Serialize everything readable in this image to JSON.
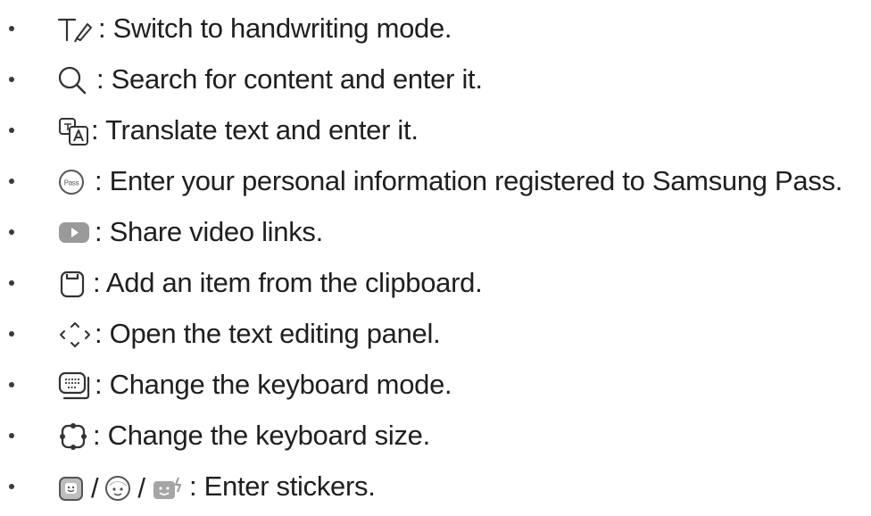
{
  "items": [
    {
      "icon": "handwriting-icon",
      "text": ": Switch to handwriting mode."
    },
    {
      "icon": "search-icon",
      "text": ": Search for content and enter it."
    },
    {
      "icon": "translate-icon",
      "text": ": Translate text and enter it."
    },
    {
      "icon": "samsung-pass-icon",
      "icon_text": "Pass",
      "text": ": Enter your personal information registered to Samsung Pass."
    },
    {
      "icon": "video-play-icon",
      "text": ": Share video links."
    },
    {
      "icon": "clipboard-icon",
      "text": ": Add an item from the clipboard."
    },
    {
      "icon": "text-editing-arrows-icon",
      "text": ": Open the text editing panel."
    },
    {
      "icon": "keyboard-mode-icon",
      "text": ": Change the keyboard mode."
    },
    {
      "icon": "keyboard-size-icon",
      "text": ": Change the keyboard size."
    },
    {
      "icon": "sticker-icons",
      "separators": [
        "/",
        "/"
      ],
      "text": ": Enter stickers."
    }
  ],
  "colors": {
    "text": "#1f1f1f",
    "icon_gray": "#8a8a8a",
    "icon_fill": "#9a9a9a",
    "sticker_fill": "#a5a5a5"
  }
}
